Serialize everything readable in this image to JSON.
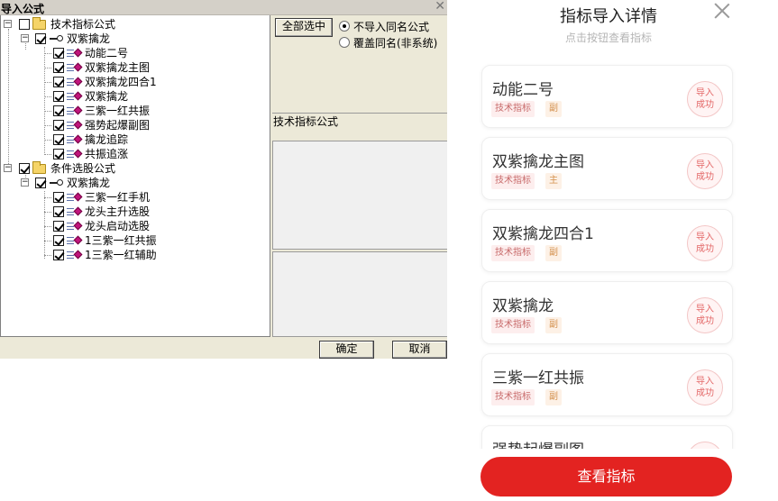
{
  "dialog": {
    "title": "导入公式",
    "close": "✕",
    "tree": {
      "groups": [
        {
          "label": "技术指标公式",
          "checked": false,
          "node": {
            "label": "双紫擒龙",
            "checked": true,
            "items": [
              "动能二号",
              "双紫擒龙主图",
              "双紫擒龙四合1",
              "双紫擒龙",
              "三紫一红共振",
              "强势起爆副图",
              "擒龙追踪",
              "共振追涨"
            ]
          }
        },
        {
          "label": "条件选股公式",
          "checked": true,
          "node": {
            "label": "双紫擒龙",
            "checked": true,
            "items": [
              "三紫一红手机",
              "龙头主升选股",
              "龙头启动选股",
              "1三紫一红共振",
              "1三紫一红辅助"
            ]
          }
        }
      ]
    },
    "select_all": "全部选中",
    "radio_options": [
      {
        "label": "不导入同名公式",
        "selected": true
      },
      {
        "label": "覆盖同名(非系统)",
        "selected": false
      }
    ],
    "category_label": "技术指标公式",
    "ok": "确定",
    "cancel": "取消"
  },
  "mobile": {
    "title": "指标导入详情",
    "subtitle": "点击按钮查看指标",
    "cards": [
      {
        "name": "动能二号",
        "tag1": "技术指标",
        "tag2": "副",
        "status_line1": "导入",
        "status_line2": "成功"
      },
      {
        "name": "双紫擒龙主图",
        "tag1": "技术指标",
        "tag2": "主",
        "status_line1": "导入",
        "status_line2": "成功"
      },
      {
        "name": "双紫擒龙四合1",
        "tag1": "技术指标",
        "tag2": "副",
        "status_line1": "导入",
        "status_line2": "成功"
      },
      {
        "name": "双紫擒龙",
        "tag1": "技术指标",
        "tag2": "副",
        "status_line1": "导入",
        "status_line2": "成功"
      },
      {
        "name": "三紫一红共振",
        "tag1": "技术指标",
        "tag2": "副",
        "status_line1": "导入",
        "status_line2": "成功"
      },
      {
        "name": "强势起爆副图",
        "tag1": "",
        "tag2": "",
        "status_line1": "",
        "status_line2": ""
      }
    ],
    "view_button": "查看指标",
    "accent_color": "#e32321"
  }
}
